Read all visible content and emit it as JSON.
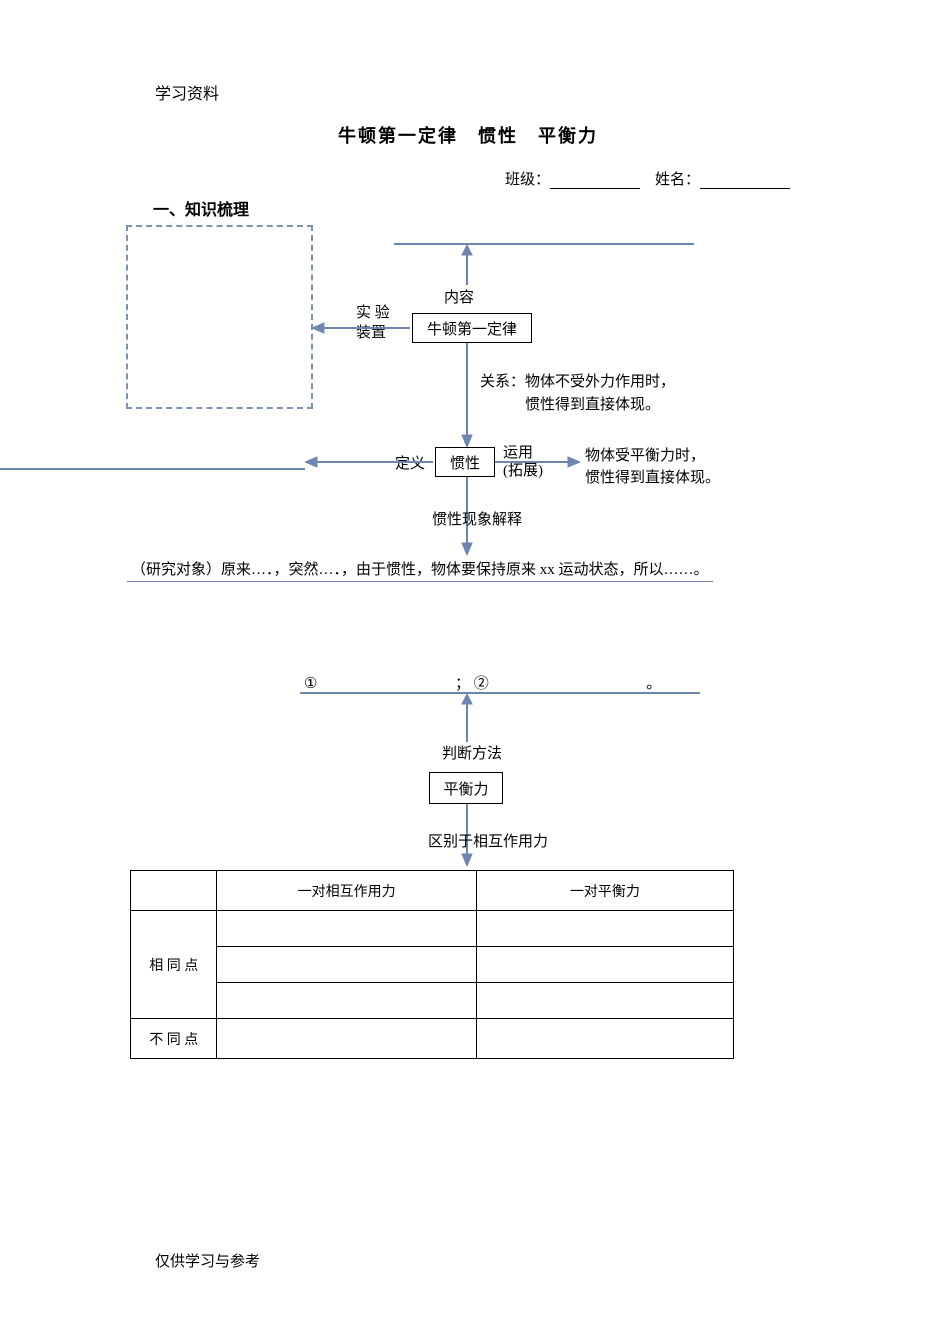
{
  "header": "学习资料",
  "title": "牛顿第一定律　惯性　平衡力",
  "class_label": "班级：",
  "name_label": "姓名：",
  "section1": "一、知识梳理",
  "diagram": {
    "content_label": "内容",
    "exp_setup": "实 验\n装置",
    "newton_box": "牛顿第一定律",
    "relation_label": "关系：",
    "relation_text1": "物体不受外力作用时，",
    "relation_text2": "惯性得到直接体现。",
    "definition_label": "定义",
    "inertia_box": "惯性",
    "apply_label": "运用\n(拓展)",
    "apply_text1": "物体受平衡力时，",
    "apply_text2": "惯性得到直接体现。",
    "phenomenon_label": "惯性现象解释",
    "explain_line": "（研究对象）原来…．，突然…．，由于惯性，物体要保持原来 xx 运动状态，所以……。"
  },
  "judgment": {
    "blank1": "①",
    "blank_sep": "；",
    "blank2": "②",
    "blank_end": "。",
    "method_label": "判断方法",
    "balance_box": "平衡力",
    "diff_label": "区别于相互作用力"
  },
  "table": {
    "col_empty": "",
    "col1": "一对相互作用力",
    "col2": "一对平衡力",
    "row_similar": "相 同 点",
    "row_diff": "不 同 点"
  },
  "footer": "仅供学习与参考"
}
